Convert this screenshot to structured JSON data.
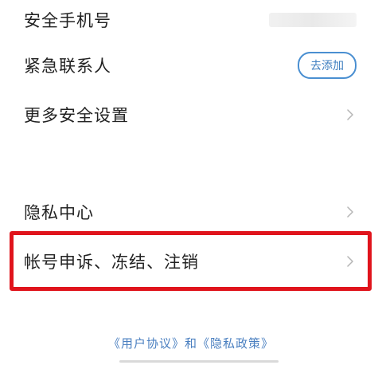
{
  "rows": {
    "safety_phone": {
      "label": "安全手机号"
    },
    "emergency_contact": {
      "label": "紧急联系人",
      "button_label": "去添加"
    },
    "more_security": {
      "label": "更多安全设置"
    },
    "privacy_center": {
      "label": "隐私中心"
    },
    "account_appeal": {
      "label": "帐号申诉、冻结、注销"
    }
  },
  "footer": {
    "link_text": "《用户协议》和《隐私政策》"
  },
  "colors": {
    "highlight_border": "#e0141c",
    "accent_blue": "#4a8fd1",
    "chevron_gray": "#b5b5b5"
  },
  "icons": {
    "chevron": "chevron-right-icon"
  }
}
